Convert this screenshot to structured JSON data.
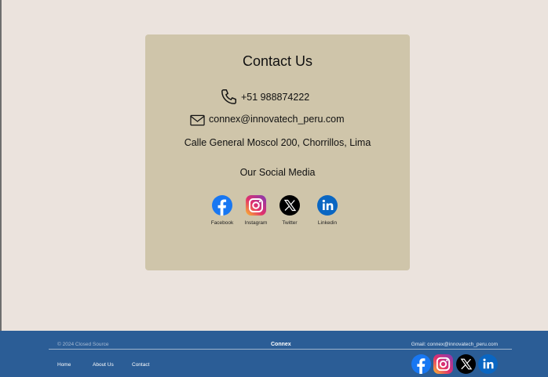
{
  "contact": {
    "title": "Contact Us",
    "phone": "+51 988874222",
    "email": "connex@innovatech_peru.com",
    "address": "Calle General Moscol 200, Chorrillos, Lima",
    "social_title": "Our Social Media",
    "socials": [
      {
        "label": "Facebook",
        "icon": "facebook-icon"
      },
      {
        "label": "Instagram",
        "icon": "instagram-icon"
      },
      {
        "label": "Twitter",
        "icon": "twitter-x-icon"
      },
      {
        "label": "Linkedin",
        "icon": "linkedin-icon"
      }
    ]
  },
  "footer": {
    "copyright": "© 2024 Closed Source",
    "brand": "Connex",
    "gmail": "Gmail: connex@innovatech_peru.com",
    "nav": [
      {
        "label": "Home"
      },
      {
        "label": "About Us"
      },
      {
        "label": "Contact"
      }
    ],
    "socials": [
      "facebook-icon",
      "instagram-icon",
      "twitter-x-icon",
      "linkedin-icon"
    ]
  },
  "colors": {
    "page_bg": "#ebe3dd",
    "card_bg": "#cfc5aa",
    "footer_bg": "#2b5d96",
    "facebook": "#1877f2",
    "linkedin": "#0a66c2"
  }
}
